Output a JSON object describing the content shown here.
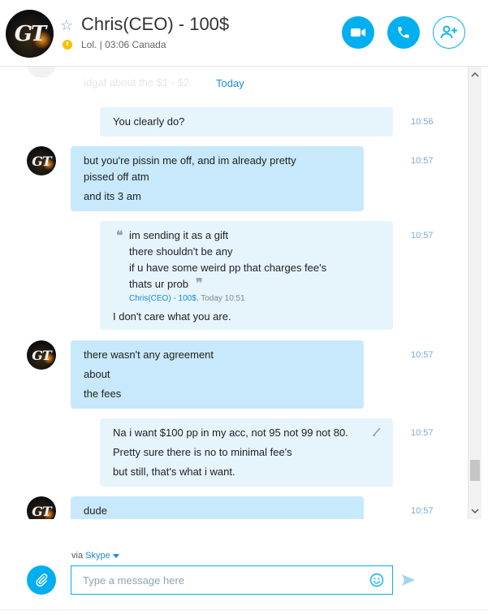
{
  "header": {
    "contact_name": "Chris(CEO) - 100$",
    "contact_status": "Lol. | 03:06 Canada",
    "avatar_initials": "GT",
    "favorite_icon": "star-outline-icon",
    "status_icon": "away-clock-icon",
    "video_icon": "video-camera-icon",
    "call_icon": "phone-icon",
    "add_people_icon": "add-person-icon"
  },
  "chat": {
    "faded_preview": "idgaf about the $1 - $2",
    "date_divider": "Today",
    "messages": [
      {
        "time": "10:56",
        "lines": [
          "You clearly do?"
        ]
      },
      {
        "time": "10:57",
        "lines": [
          "but you're pissin me off, and im already pretty",
          "pissed off atm",
          "and its 3 am"
        ]
      },
      {
        "time": "10:57",
        "quote": {
          "lines": [
            "im sending it as a gift",
            "there shouldn't be any",
            "if u have some weird pp that charges fee's",
            "thats ur prob"
          ],
          "author": "Chris(CEO) - 100$",
          "meta": ", Today 10:51"
        },
        "lines": [
          "I don't care what you are."
        ]
      },
      {
        "time": "10:57",
        "lines": [
          "there wasn't any agreement",
          "about",
          "the fees"
        ]
      },
      {
        "time": "10:57",
        "lines": [
          "Na i want $100 pp in my acc, not 95 not 99 not 80.",
          "Pretty sure there is no to minimal fee's",
          "but still, that's what i want."
        ]
      },
      {
        "time": "10:57",
        "lines": [
          "dude"
        ]
      }
    ]
  },
  "footer": {
    "via_prefix": "via",
    "via_service": "Skype",
    "input_placeholder": "Type a message here",
    "input_value": "",
    "attach_icon": "paperclip-icon",
    "emoji_icon": "smiley-icon",
    "send_icon": "send-arrow-icon"
  },
  "colors": {
    "accent": "#00aff0",
    "incoming_bubble": "#c7e9fb",
    "outgoing_bubble": "#e6f4fc",
    "link": "#1a8cd8",
    "timestamp": "#7aa9cf",
    "away_status": "#f8c100"
  }
}
